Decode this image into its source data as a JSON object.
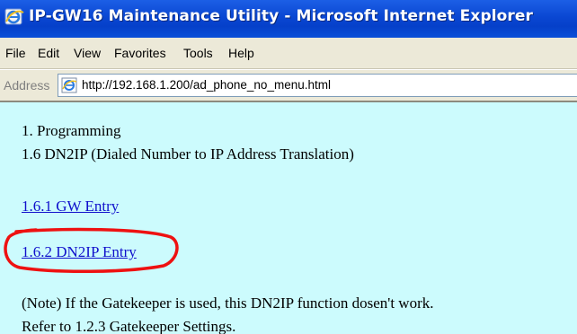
{
  "window": {
    "title": "IP-GW16 Maintenance Utility - Microsoft Internet Explorer"
  },
  "menu": {
    "items": [
      "File",
      "Edit",
      "View",
      "Favorites",
      "Tools",
      "Help"
    ]
  },
  "address_bar": {
    "label": "Address",
    "url": "http://192.168.1.200/ad_phone_no_menu.html"
  },
  "content": {
    "section": "1. Programming",
    "subtitle": "1.6 DN2IP (Dialed Number to IP Address Translation)",
    "links": [
      {
        "label": "1.6.1 GW Entry"
      },
      {
        "label": "1.6.2 DN2IP Entry"
      }
    ],
    "note_line1": "(Note) If the Gatekeeper is used, this DN2IP function dosen't work.",
    "note_line2": "Refer to 1.2.3 Gatekeeper Settings."
  },
  "colors": {
    "titlebar": "#0a47d3",
    "page_background": "#ccfbfd",
    "link": "#1010cc",
    "highlight_circle": "#ee1111"
  },
  "icons": {
    "title": "ie-icon",
    "address": "page-icon"
  }
}
